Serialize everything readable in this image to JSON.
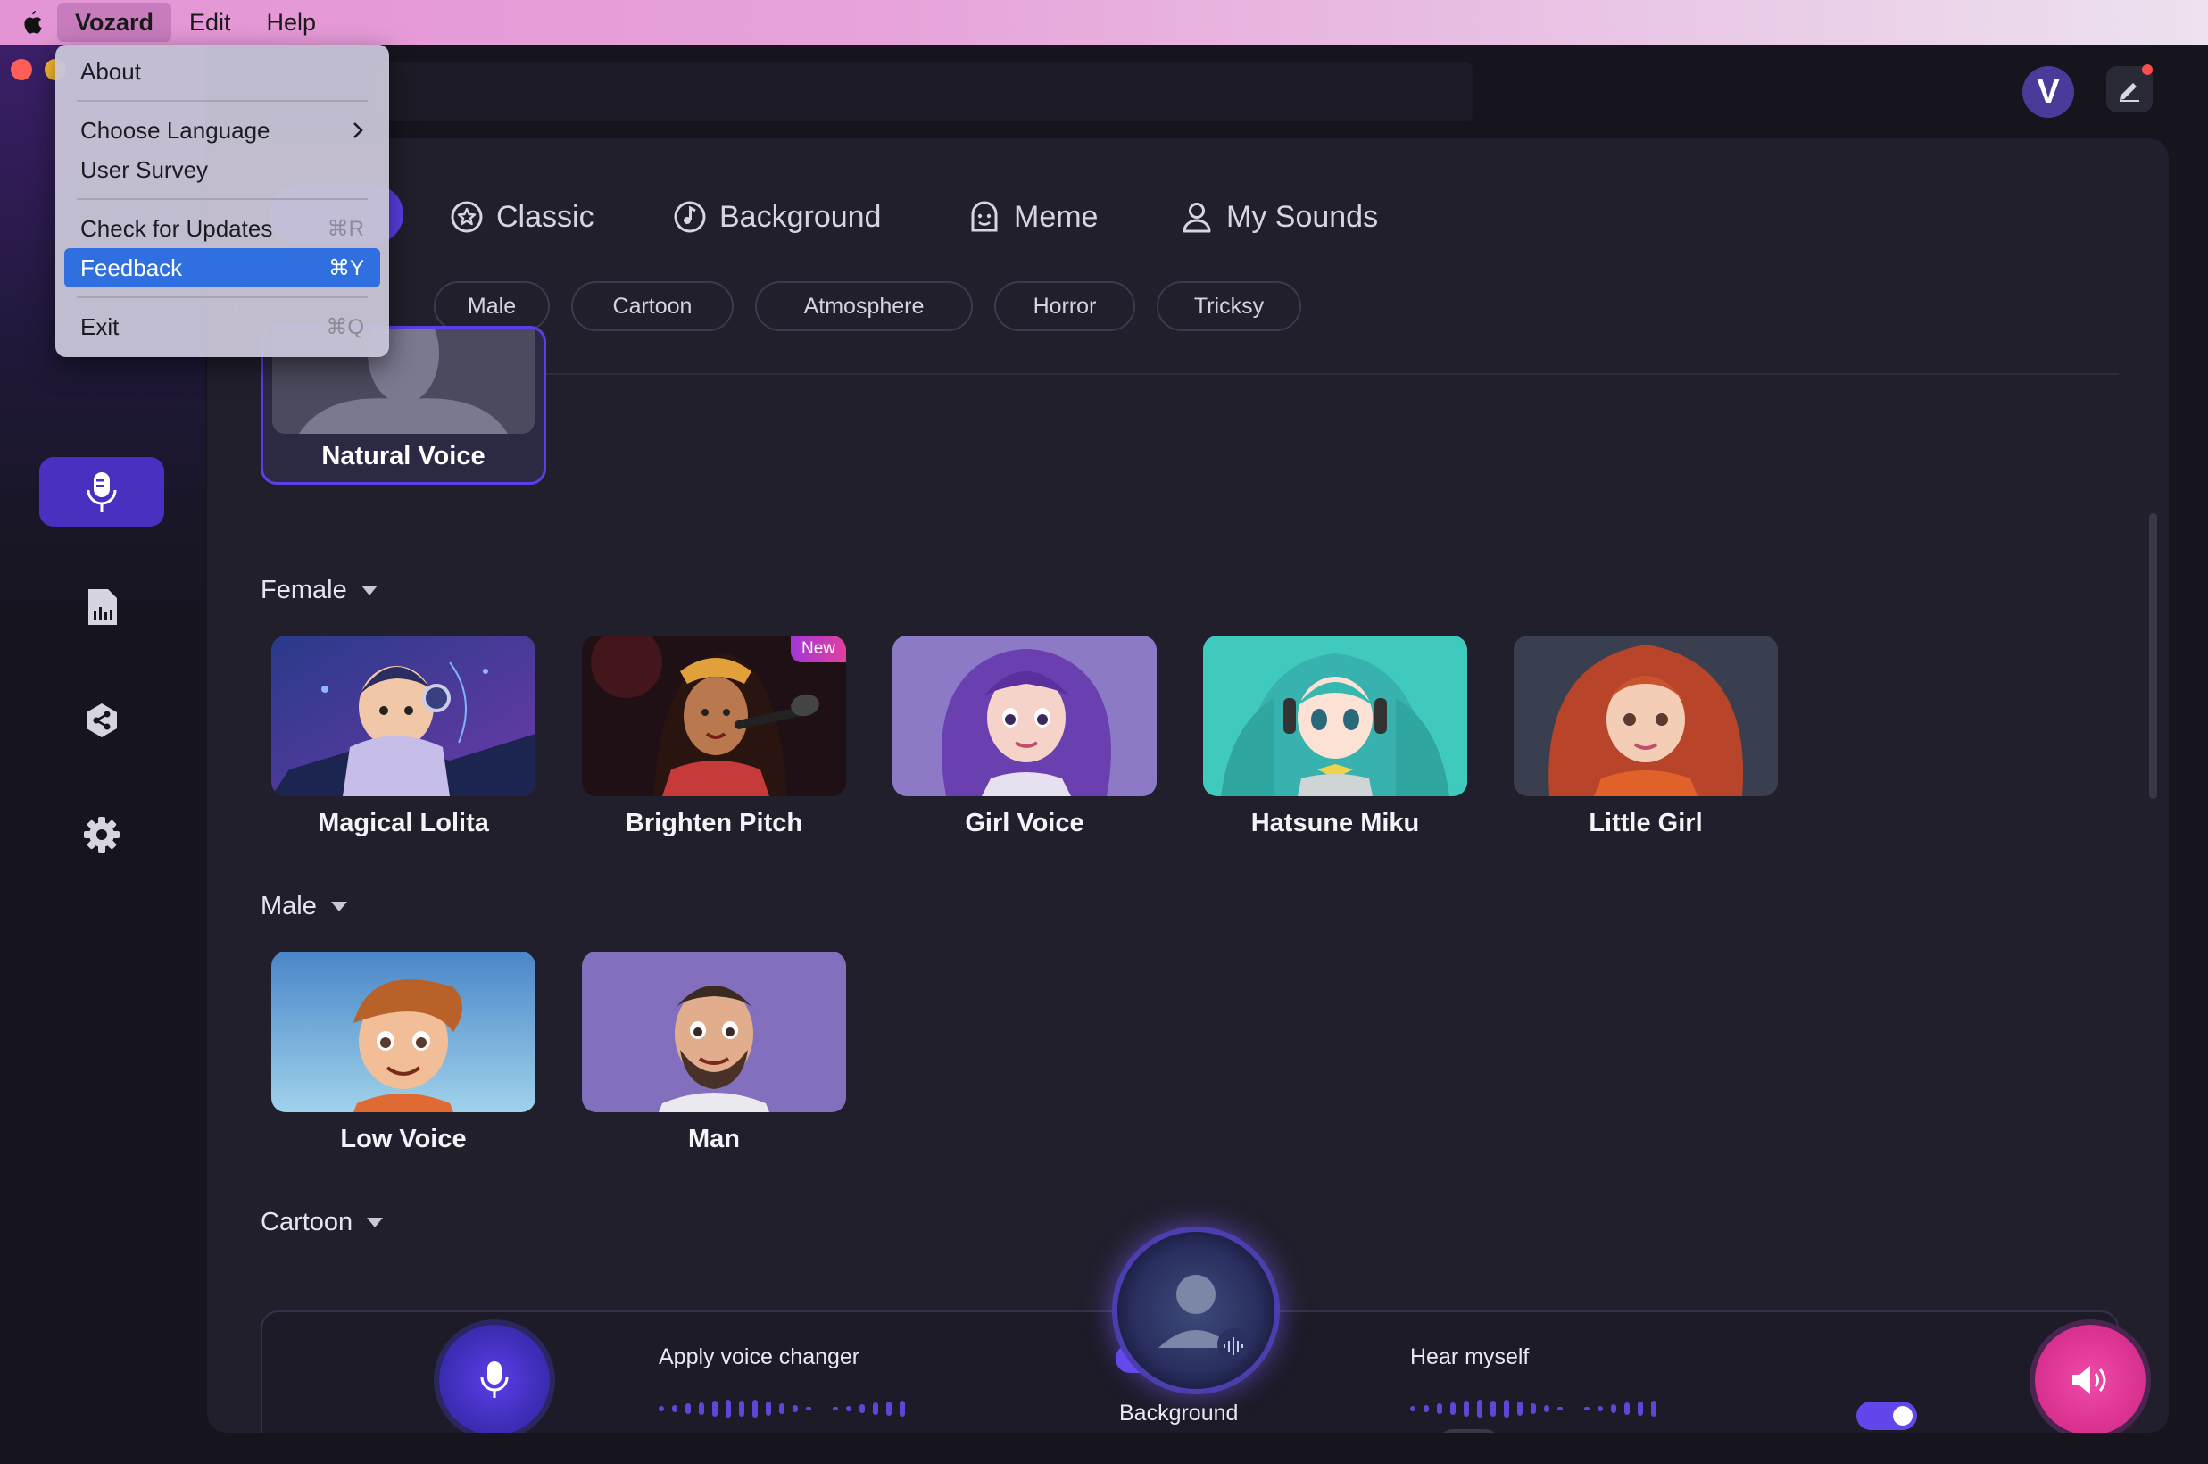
{
  "menubar": {
    "app": "Vozard",
    "edit": "Edit",
    "help": "Help"
  },
  "app_menu": {
    "about": "About",
    "choose_language": "Choose Language",
    "user_survey": "User Survey",
    "check_updates": "Check for Updates",
    "check_updates_shortcut": "⌘R",
    "feedback": "Feedback",
    "feedback_shortcut": "⌘Y",
    "exit": "Exit",
    "exit_shortcut": "⌘Q"
  },
  "header": {
    "avatar_letter": "V"
  },
  "tabs": [
    "Classic",
    "Background",
    "Meme",
    "My Sounds"
  ],
  "filters": [
    "Male",
    "Cartoon",
    "Atmosphere",
    "Horror",
    "Tricksy"
  ],
  "natural_voice": "Natural Voice",
  "sections": {
    "female": {
      "title": "Female",
      "items": [
        "Magical Lolita",
        "Brighten Pitch",
        "Girl Voice",
        "Hatsune Miku",
        "Little Girl"
      ],
      "badge": "New"
    },
    "male": {
      "title": "Male",
      "items": [
        "Low Voice",
        "Man"
      ]
    },
    "cartoon": {
      "title": "Cartoon"
    }
  },
  "controls": {
    "apply_voice_changer": "Apply voice changer",
    "apply_voice_changer_on": true,
    "hear_myself": "Hear myself",
    "hear_myself_on": true,
    "background": "Background",
    "background_on": false
  },
  "colors": {
    "accent": "#5b3fe6",
    "speaker": "#e0409a",
    "menu_highlight": "#2f6fe0"
  }
}
